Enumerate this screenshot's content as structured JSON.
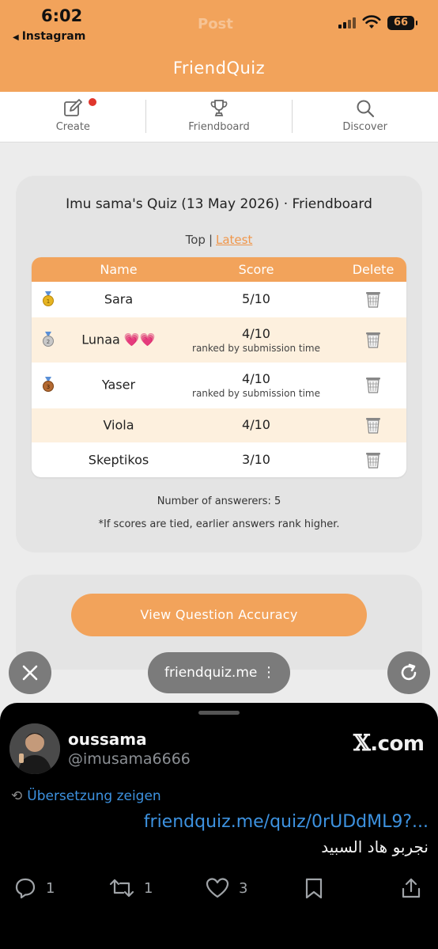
{
  "status_bar": {
    "time": "6:02",
    "back_app": "Instagram",
    "ghost_title": "Post",
    "battery": "66"
  },
  "header": {
    "title": "FriendQuiz"
  },
  "tabs": [
    {
      "label": "Create",
      "icon": "edit-icon",
      "has_notification": true
    },
    {
      "label": "Friendboard",
      "icon": "trophy-icon"
    },
    {
      "label": "Discover",
      "icon": "search-icon"
    }
  ],
  "board": {
    "title": "Imu sama's Quiz (13 May 2026) · Friendboard",
    "sort_top": "Top",
    "sort_separator": "|",
    "sort_latest": "Latest",
    "columns": {
      "name": "Name",
      "score": "Score",
      "delete": "Delete"
    },
    "rows": [
      {
        "name": "Sara",
        "score": "5/10",
        "note": "",
        "medal": "gold-medal-icon"
      },
      {
        "name": "Lunaa 💗💗",
        "score": "4/10",
        "note": "ranked by submission time",
        "medal": "silver-medal-icon"
      },
      {
        "name": "Yaser",
        "score": "4/10",
        "note": "ranked by submission time",
        "medal": "bronze-medal-icon"
      },
      {
        "name": "Viola",
        "score": "4/10",
        "note": "",
        "medal": ""
      },
      {
        "name": "Skeptikos",
        "score": "3/10",
        "note": "",
        "medal": ""
      }
    ],
    "answerers": "Number of answerers: 5",
    "tie_note": "*If scores are tied, earlier answers rank higher."
  },
  "accuracy_button": "View Question Accuracy",
  "browser": {
    "url": "friendquiz.me",
    "kebab": "⋮"
  },
  "post": {
    "display_name": "oussama",
    "handle": "@imusama6666",
    "source_logo_x": "𝕏",
    "source_logo_text": ".com",
    "translate": "Übersetzung zeigen",
    "link": "friendquiz.me/quiz/0rUDdML9?...",
    "text": "نجربو هاد السبيد",
    "replies": "1",
    "reposts": "1",
    "likes": "3"
  },
  "colors": {
    "brand_orange": "#f2a35b",
    "row_alt": "#fdf0de",
    "link_blue": "#3d92e0",
    "notification_red": "#e0362c"
  }
}
